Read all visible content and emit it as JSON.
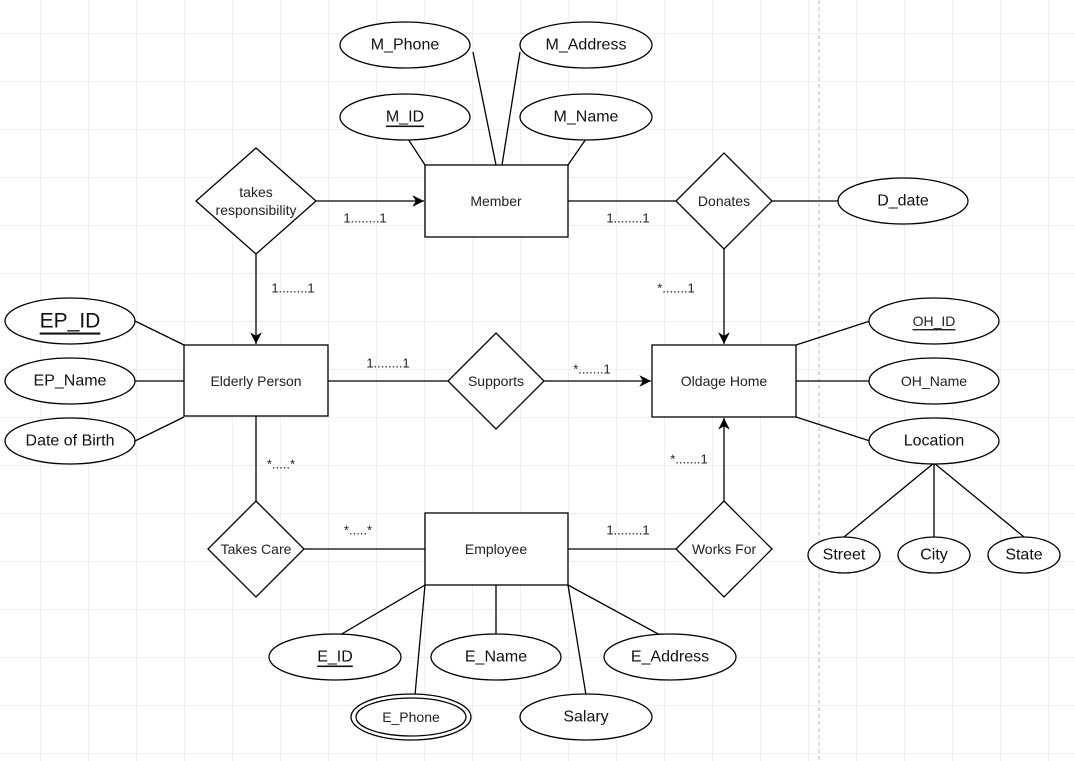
{
  "colors": {
    "stroke": "#000000",
    "grid": "#e0e0e0",
    "background": "#ffffff"
  },
  "entities": {
    "member": "Member",
    "elderly_person": "Elderly Person",
    "oldage_home": "Oldage Home",
    "employee": "Employee"
  },
  "relationships": {
    "takes_responsibility": [
      "takes",
      "responsibility"
    ],
    "donates": "Donates",
    "supports": "Supports",
    "takes_care": "Takes Care",
    "works_for": "Works For"
  },
  "attributes": {
    "member": {
      "phone": "M_Phone",
      "address": "M_Address",
      "id": "M_ID",
      "name": "M_Name"
    },
    "donates": {
      "date": "D_date"
    },
    "elderly_person": {
      "id": "EP_ID",
      "name": "EP_Name",
      "dob": "Date of Birth"
    },
    "oldage_home": {
      "id": "OH_ID",
      "name": "OH_Name",
      "location": "Location",
      "street": "Street",
      "city": "City",
      "state": "State"
    },
    "employee": {
      "id": "E_ID",
      "name": "E_Name",
      "address": "E_Address",
      "phone": "E_Phone",
      "salary": "Salary"
    }
  },
  "cardinalities": {
    "tr_member": "1........1",
    "tr_elderly": "1........1",
    "member_donates": "1........1",
    "donates_home": "*.......1",
    "elderly_supports": "1........1",
    "supports_home": "*.......1",
    "elderly_takescare": "*.....*",
    "takescare_employee": "*.....*",
    "employee_worksfor": "1........1",
    "worksfor_home": "*.......1"
  }
}
